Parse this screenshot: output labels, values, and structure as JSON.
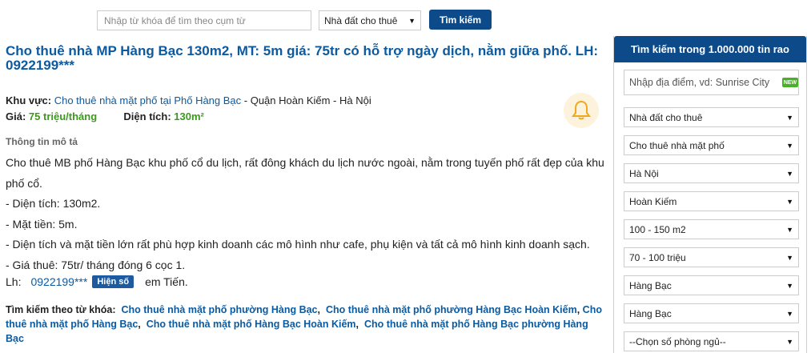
{
  "top_bar": {
    "search_placeholder": "Nhập từ khóa để tìm theo cụm từ",
    "category_select": "Nhà đất cho thuê",
    "search_button": "Tìm kiếm"
  },
  "listing": {
    "title": "Cho thuê nhà MP Hàng Bạc 130m2, MT: 5m giá: 75tr có hỗ trợ ngày dịch, nằm giữa phố. LH: 0922199***",
    "area_label": "Khu vực:",
    "area_link": "Cho thuê nhà mặt phố tại Phố Hàng Bạc",
    "area_rest": " - Quận Hoàn Kiếm - Hà Nội",
    "price_label": "Giá:",
    "price_value": "75 triệu/tháng",
    "size_label": "Diện tích:",
    "size_value": "130m²",
    "desc_heading": "Thông tin mô tả",
    "desc_lines": [
      "Cho thuê MB phố Hàng Bạc khu phố cổ du lịch, rất đông khách du lịch nước ngoài, nằm trong tuyến phố rất đẹp của khu phố cổ.",
      "- Diện tích: 130m2.",
      "- Mặt tiền: 5m.",
      "- Diện tích và mặt tiền lớn rất phù hợp kinh doanh các mô hình như cafe, phụ kiện và tất cả mô hình kinh doanh sạch.",
      "- Giá thuê: 75tr/ tháng đóng 6 cọc 1."
    ],
    "contact_label": "Lh:",
    "contact_phone": "0922199***",
    "show_number": "Hiện số",
    "contact_name": "em Tiến.",
    "keywords_label": "Tìm kiếm theo từ khóa:",
    "keywords": [
      "Cho thuê nhà mặt phố phường Hàng Bạc",
      "Cho thuê nhà mặt phố phường Hàng Bạc Hoàn Kiếm",
      "Cho thuê nhà mặt phố Hàng Bạc",
      "Cho thuê nhà mặt phố Hàng Bạc Hoàn Kiếm",
      "Cho thuê nhà mặt phố Hàng Bạc phường Hàng Bạc"
    ]
  },
  "sidebar": {
    "header": "Tìm kiếm trong 1.000.000 tin rao",
    "location_placeholder": "Nhập địa điểm, vd: Sunrise City",
    "new_badge": "NEW",
    "selects": [
      "Nhà đất cho thuê",
      "Cho thuê nhà mặt phố",
      "Hà Nội",
      "Hoàn Kiếm",
      "100 - 150 m2",
      "70 - 100 triệu",
      "Hàng Bạc",
      "Hàng Bạc",
      "--Chọn số phòng ngủ--"
    ]
  },
  "icons": {
    "bell": "bell-icon",
    "dropdown": "chevron-down-icon"
  },
  "colors": {
    "brand": "#0c4a8a",
    "link": "#0c5aa0",
    "price": "#3a9a1c"
  }
}
